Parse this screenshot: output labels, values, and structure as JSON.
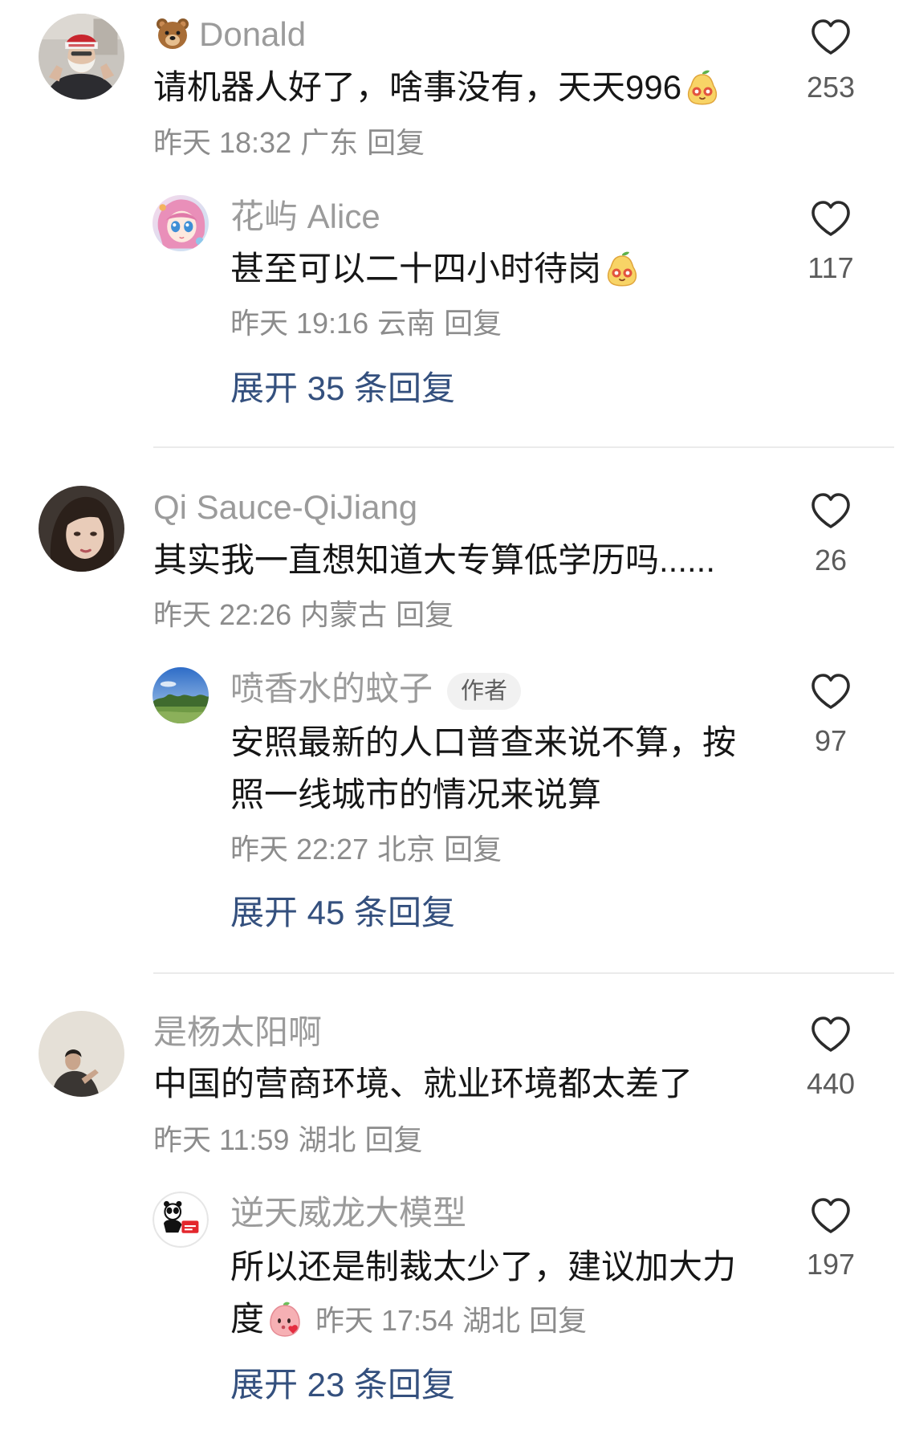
{
  "icons": {
    "like": "heart-outline-icon",
    "name_emoji": "bear-face-emoji",
    "pear_emoji": "yellow-pear-face-emoji",
    "peach_emoji": "pink-peach-face-emoji"
  },
  "threads": [
    {
      "comment": {
        "name_emoji": "bear-face-emoji",
        "name": "Donald",
        "text": "请机器人好了，啥事没有，天天996",
        "text_emoji": "yellow-pear-face-emoji",
        "time": "昨天 18:32",
        "location": "广东",
        "reply_action": "回复",
        "likes": "253"
      },
      "reply": {
        "name": "花屿 Alice",
        "text": "甚至可以二十四小时待岗",
        "text_emoji": "yellow-pear-face-emoji",
        "time": "昨天 19:16",
        "location": "云南",
        "reply_action": "回复",
        "likes": "117"
      },
      "expand_replies": "展开 35 条回复"
    },
    {
      "comment": {
        "name": "Qi Sauce-QiJiang",
        "text": "其实我一直想知道大专算低学历吗......",
        "time": "昨天 22:26",
        "location": "内蒙古",
        "reply_action": "回复",
        "likes": "26"
      },
      "reply": {
        "name": "喷香水的蚊子",
        "badge": "作者",
        "text_lines": [
          "安照最新的人口普查来说不算，按",
          "照一线城市的情况来说算"
        ],
        "time": "昨天 22:27",
        "location": "北京",
        "reply_action": "回复",
        "likes": "97"
      },
      "expand_replies": "展开 45 条回复"
    },
    {
      "comment": {
        "name": "是杨太阳啊",
        "text": "中国的营商环境、就业环境都太差了",
        "time": "昨天 11:59",
        "location": "湖北",
        "reply_action": "回复",
        "likes": "440"
      },
      "reply": {
        "name": "逆天威龙大模型",
        "text_lines": [
          "所以还是制裁太少了，建议加大力",
          "度"
        ],
        "text_emoji": "pink-peach-face-emoji",
        "time": "昨天 17:54",
        "location": "湖北",
        "reply_action": "回复",
        "likes": "197"
      },
      "expand_replies": "展开 23 条回复"
    }
  ],
  "colors": {
    "background": "#ffffff",
    "comment_text": "#161616",
    "username": "#9b9b9b",
    "meta": "#8c8c8c",
    "expand_link": "#34507e",
    "like_count": "#5b5b5b",
    "icon": "#2b2b2b",
    "divider": "#ebebeb",
    "badge_bg": "#f1f1f1",
    "badge_text": "#5e5e5e"
  }
}
